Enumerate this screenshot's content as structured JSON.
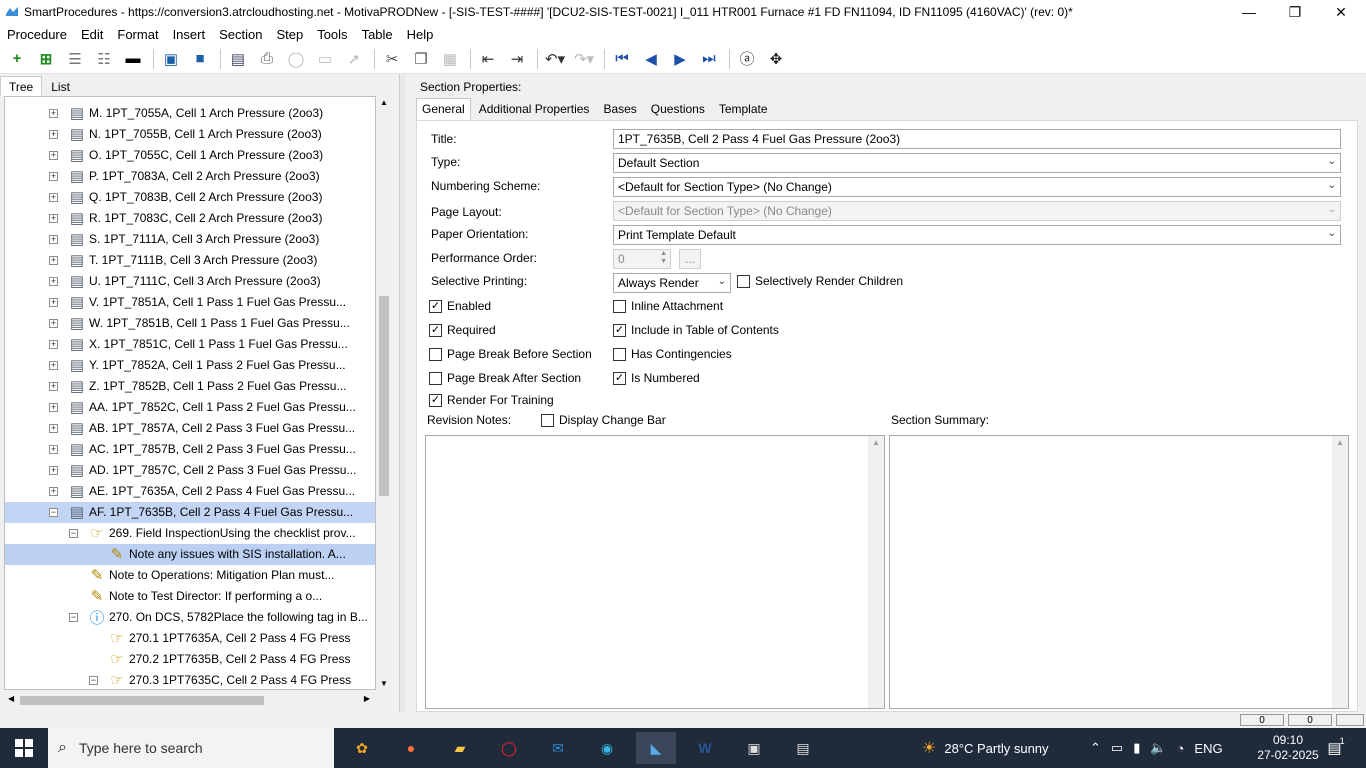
{
  "window": {
    "title": "SmartProcedures - https://conversion3.atrcloudhosting.net - MotivaPRODNew - [-SIS-TEST-####] '[DCU2-SIS-TEST-0021] I_011 HTR001 Furnace #1 FD FN11094, ID FN11095 (4160VAC)' (rev: 0)*",
    "min": "—",
    "max": "❐",
    "close": "✕"
  },
  "menu": [
    "Procedure",
    "Edit",
    "Format",
    "Insert",
    "Section",
    "Step",
    "Tools",
    "Table",
    "Help"
  ],
  "left_tabs": [
    "Tree",
    "List"
  ],
  "tree": [
    {
      "label": "M. 1PT_7055A, Cell 1 Arch Pressure (2oo3)",
      "icon": "section-icon",
      "exp": "+"
    },
    {
      "label": "N. 1PT_7055B, Cell 1 Arch Pressure (2oo3)",
      "icon": "section-icon",
      "exp": "+"
    },
    {
      "label": "O. 1PT_7055C, Cell 1 Arch Pressure (2oo3)",
      "icon": "section-icon",
      "exp": "+"
    },
    {
      "label": "P. 1PT_7083A, Cell 2 Arch Pressure (2oo3)",
      "icon": "section-icon",
      "exp": "+"
    },
    {
      "label": "Q. 1PT_7083B, Cell 2 Arch Pressure (2oo3)",
      "icon": "section-icon",
      "exp": "+"
    },
    {
      "label": "R. 1PT_7083C, Cell 2 Arch Pressure (2oo3)",
      "icon": "section-icon",
      "exp": "+"
    },
    {
      "label": "S. 1PT_7111A, Cell 3 Arch Pressure (2oo3)",
      "icon": "section-icon",
      "exp": "+"
    },
    {
      "label": "T. 1PT_7111B, Cell 3 Arch Pressure (2oo3)",
      "icon": "section-icon",
      "exp": "+"
    },
    {
      "label": "U. 1PT_7111C, Cell 3 Arch Pressure (2oo3)",
      "icon": "section-icon",
      "exp": "+"
    },
    {
      "label": "V. 1PT_7851A, Cell 1 Pass 1 Fuel Gas Pressu...",
      "icon": "section-icon",
      "exp": "+"
    },
    {
      "label": "W. 1PT_7851B, Cell 1 Pass 1 Fuel Gas Pressu...",
      "icon": "section-icon",
      "exp": "+"
    },
    {
      "label": "X. 1PT_7851C, Cell 1 Pass 1 Fuel Gas Pressu...",
      "icon": "section-icon",
      "exp": "+"
    },
    {
      "label": "Y. 1PT_7852A, Cell 1 Pass 2 Fuel Gas Pressu...",
      "icon": "section-icon",
      "exp": "+"
    },
    {
      "label": "Z. 1PT_7852B, Cell 1 Pass 2 Fuel Gas Pressu...",
      "icon": "section-icon",
      "exp": "+"
    },
    {
      "label": "AA. 1PT_7852C, Cell 1 Pass 2 Fuel Gas Pressu...",
      "icon": "section-icon",
      "exp": "+"
    },
    {
      "label": "AB. 1PT_7857A, Cell 2 Pass 3 Fuel Gas Pressu...",
      "icon": "section-icon",
      "exp": "+"
    },
    {
      "label": "AC. 1PT_7857B, Cell 2 Pass 3 Fuel Gas Pressu...",
      "icon": "section-icon",
      "exp": "+"
    },
    {
      "label": "AD. 1PT_7857C, Cell 2 Pass 3 Fuel Gas Pressu...",
      "icon": "section-icon",
      "exp": "+"
    },
    {
      "label": "AE. 1PT_7635A, Cell 2 Pass 4 Fuel Gas Pressu...",
      "icon": "section-icon",
      "exp": "+"
    },
    {
      "label": "AF. 1PT_7635B, Cell 2 Pass 4 Fuel Gas Pressu...",
      "icon": "section-icon",
      "exp": "−"
    },
    {
      "label": "269. Field InspectionUsing the checklist prov...",
      "icon": "hand-icon",
      "exp": "−"
    },
    {
      "label": "Note any issues with SIS installation. A...",
      "icon": "note-icon",
      "exp": ""
    },
    {
      "label": "Note to Operations: Mitigation Plan must...",
      "icon": "note-icon",
      "exp": ""
    },
    {
      "label": "Note to Test Director: If performing a o...",
      "icon": "note-icon",
      "exp": ""
    },
    {
      "label": "270. On DCS, 5782Place the following tag in B...",
      "icon": "info-icon",
      "exp": "−"
    },
    {
      "label": "270.1 1PT7635A, Cell 2 Pass 4 FG Press",
      "icon": "hand-icon",
      "exp": ""
    },
    {
      "label": "270.2 1PT7635B, Cell 2 Pass 4 FG Press",
      "icon": "hand-icon",
      "exp": ""
    },
    {
      "label": "270.3 1PT7635C, Cell 2 Pass 4 FG Press",
      "icon": "hand-icon",
      "exp": "−"
    }
  ],
  "section_props": {
    "heading": "Section Properties:",
    "tabs": [
      "General",
      "Additional Properties",
      "Bases",
      "Questions",
      "Template"
    ],
    "title_label": "Title:",
    "title_value": "1PT_7635B, Cell 2 Pass 4 Fuel Gas Pressure (2oo3)",
    "type_label": "Type:",
    "type_value": "Default Section",
    "numbering_label": "Numbering Scheme:",
    "numbering_value": "<Default for Section Type> (No Change)",
    "layout_label": "Page Layout:",
    "layout_value": "<Default for Section Type> (No Change)",
    "orientation_label": "Paper Orientation:",
    "orientation_value": "Print Template Default",
    "perf_label": "Performance Order:",
    "perf_value": "0",
    "perf_btn": "...",
    "selective_label": "Selective Printing:",
    "selective_value": "Always Render",
    "sel_render_children": "Selectively Render Children",
    "enabled": "Enabled",
    "inline_attachment": "Inline Attachment",
    "required": "Required",
    "include_toc": "Include in Table of Contents",
    "page_break_before": "Page Break Before Section",
    "has_contingencies": "Has Contingencies",
    "page_break_after": "Page Break After Section",
    "is_numbered": "Is Numbered",
    "render_training": "Render For Training",
    "revision_notes": "Revision Notes:",
    "display_change_bar": "Display Change Bar",
    "section_summary": "Section Summary:"
  },
  "status": {
    "box1": "0",
    "box2": "0"
  },
  "taskbar": {
    "search_placeholder": "Type here to search",
    "weather": "28°C  Partly sunny",
    "lang": "ENG",
    "time": "09:10",
    "date": "27-02-2025",
    "notif_count": "1"
  }
}
